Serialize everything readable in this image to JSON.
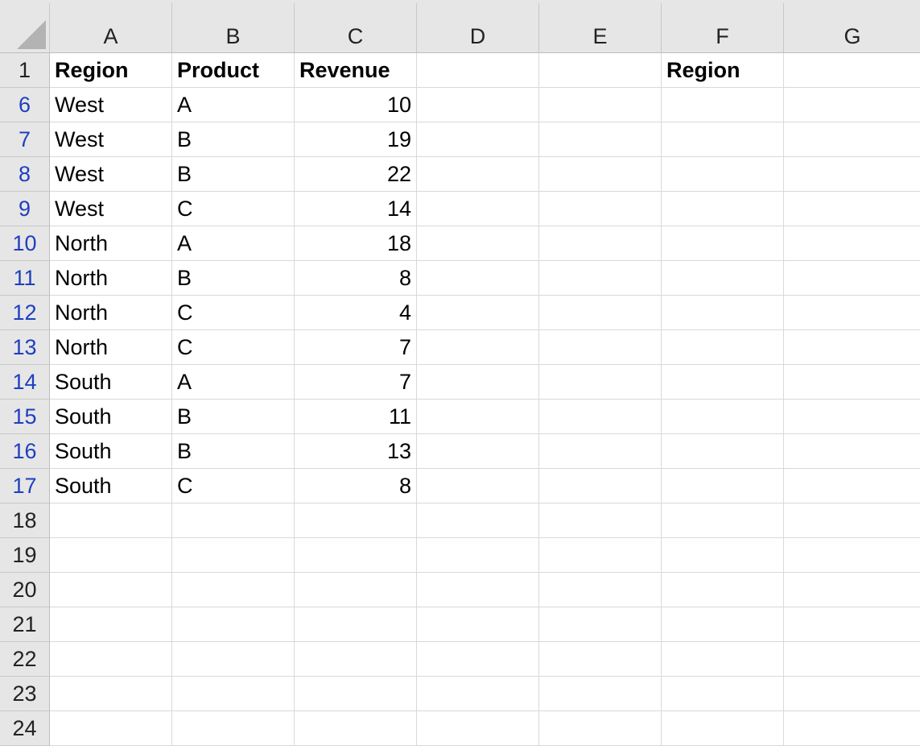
{
  "columns": [
    "A",
    "B",
    "C",
    "D",
    "E",
    "F",
    "G"
  ],
  "header_row": {
    "row_number": "1",
    "cells": [
      "Region",
      "Product",
      "Revenue",
      "",
      "",
      "Region",
      ""
    ]
  },
  "data_rows": [
    {
      "row_number": "6",
      "filtered": true,
      "cells": [
        "West",
        "A",
        "10",
        "",
        "",
        "",
        ""
      ]
    },
    {
      "row_number": "7",
      "filtered": true,
      "cells": [
        "West",
        "B",
        "19",
        "",
        "",
        "",
        ""
      ]
    },
    {
      "row_number": "8",
      "filtered": true,
      "cells": [
        "West",
        "B",
        "22",
        "",
        "",
        "",
        ""
      ]
    },
    {
      "row_number": "9",
      "filtered": true,
      "cells": [
        "West",
        "C",
        "14",
        "",
        "",
        "",
        ""
      ]
    },
    {
      "row_number": "10",
      "filtered": true,
      "cells": [
        "North",
        "A",
        "18",
        "",
        "",
        "",
        ""
      ]
    },
    {
      "row_number": "11",
      "filtered": true,
      "cells": [
        "North",
        "B",
        "8",
        "",
        "",
        "",
        ""
      ]
    },
    {
      "row_number": "12",
      "filtered": true,
      "cells": [
        "North",
        "C",
        "4",
        "",
        "",
        "",
        ""
      ]
    },
    {
      "row_number": "13",
      "filtered": true,
      "cells": [
        "North",
        "C",
        "7",
        "",
        "",
        "",
        ""
      ]
    },
    {
      "row_number": "14",
      "filtered": true,
      "cells": [
        "South",
        "A",
        "7",
        "",
        "",
        "",
        ""
      ]
    },
    {
      "row_number": "15",
      "filtered": true,
      "cells": [
        "South",
        "B",
        "11",
        "",
        "",
        "",
        ""
      ]
    },
    {
      "row_number": "16",
      "filtered": true,
      "cells": [
        "South",
        "B",
        "13",
        "",
        "",
        "",
        ""
      ]
    },
    {
      "row_number": "17",
      "filtered": true,
      "cells": [
        "South",
        "C",
        "8",
        "",
        "",
        "",
        ""
      ]
    },
    {
      "row_number": "18",
      "filtered": false,
      "cells": [
        "",
        "",
        "",
        "",
        "",
        "",
        ""
      ]
    },
    {
      "row_number": "19",
      "filtered": false,
      "cells": [
        "",
        "",
        "",
        "",
        "",
        "",
        ""
      ]
    },
    {
      "row_number": "20",
      "filtered": false,
      "cells": [
        "",
        "",
        "",
        "",
        "",
        "",
        ""
      ]
    },
    {
      "row_number": "21",
      "filtered": false,
      "cells": [
        "",
        "",
        "",
        "",
        "",
        "",
        ""
      ]
    },
    {
      "row_number": "22",
      "filtered": false,
      "cells": [
        "",
        "",
        "",
        "",
        "",
        "",
        ""
      ]
    },
    {
      "row_number": "23",
      "filtered": false,
      "cells": [
        "",
        "",
        "",
        "",
        "",
        "",
        ""
      ]
    },
    {
      "row_number": "24",
      "filtered": false,
      "cells": [
        "",
        "",
        "",
        "",
        "",
        "",
        ""
      ]
    }
  ],
  "colors": {
    "filtered_row_number": "#1f3fbf",
    "header_background": "#e6e6e6",
    "gridline": "#d9d9d9"
  }
}
